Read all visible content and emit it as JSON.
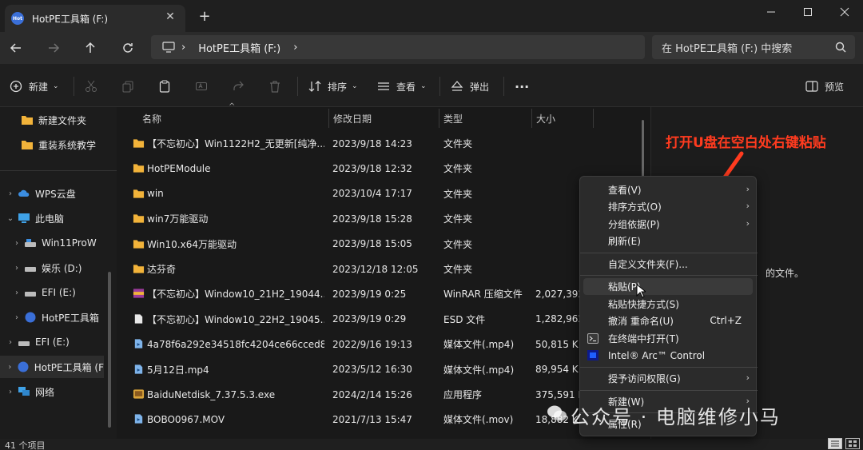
{
  "window": {
    "tab_title": "HotPE工具箱 (F:)",
    "tab_logo_text": "Hot",
    "tab_close": "✕",
    "new_tab": "+"
  },
  "address": {
    "segments": [
      "HotPE工具箱 (F:)"
    ],
    "search_placeholder": "在 HotPE工具箱 (F:) 中搜索"
  },
  "toolbar": {
    "new_label": "新建",
    "sort_label": "排序",
    "view_label": "查看",
    "eject_label": "弹出",
    "more_label": "···",
    "preview_label": "预览"
  },
  "sidebar": {
    "items": [
      {
        "label": "新建文件夹",
        "icon": "folder-icon"
      },
      {
        "label": "重装系统教学",
        "icon": "folder-icon"
      },
      {
        "label": "WPS云盘",
        "icon": "cloud-icon"
      },
      {
        "label": "此电脑",
        "icon": "computer-icon"
      },
      {
        "label": "Win11ProW",
        "icon": "drive-icon"
      },
      {
        "label": "娱乐 (D:)",
        "icon": "drive-icon"
      },
      {
        "label": "EFI (E:)",
        "icon": "drive-icon"
      },
      {
        "label": "HotPE工具箱",
        "icon": "hotpe-icon"
      },
      {
        "label": "EFI (E:)",
        "icon": "drive-icon"
      },
      {
        "label": "HotPE工具箱 (F",
        "icon": "hotpe-icon"
      },
      {
        "label": "网络",
        "icon": "network-icon"
      }
    ]
  },
  "columns": {
    "name": "名称",
    "date": "修改日期",
    "type": "类型",
    "size": "大小"
  },
  "files": [
    {
      "name": "【不忘初心】Win1122H2_无更新[纯净...",
      "date": "2023/9/18 14:23",
      "type": "文件夹",
      "size": "",
      "icon": "folder"
    },
    {
      "name": "HotPEModule",
      "date": "2023/9/18 12:32",
      "type": "文件夹",
      "size": "",
      "icon": "folder"
    },
    {
      "name": "win",
      "date": "2023/10/4 17:17",
      "type": "文件夹",
      "size": "",
      "icon": "folder"
    },
    {
      "name": "win7万能驱动",
      "date": "2023/9/18 15:28",
      "type": "文件夹",
      "size": "",
      "icon": "folder"
    },
    {
      "name": "Win10.x64万能驱动",
      "date": "2023/9/18 15:05",
      "type": "文件夹",
      "size": "",
      "icon": "folder"
    },
    {
      "name": "达芬奇",
      "date": "2023/12/18 12:05",
      "type": "文件夹",
      "size": "",
      "icon": "folder"
    },
    {
      "name": "【不忘初心】Window10_21H2_19044....",
      "date": "2023/9/19 0:25",
      "type": "WinRAR 压缩文件",
      "size": "2,027,392",
      "icon": "rar"
    },
    {
      "name": "【不忘初心】Window10_22H2_19045....",
      "date": "2023/9/19 0:29",
      "type": "ESD 文件",
      "size": "1,282,962",
      "icon": "file"
    },
    {
      "name": "4a78f6a292e34518fc4204ce66cced8...",
      "date": "2022/9/16 19:13",
      "type": "媒体文件(.mp4)",
      "size": "50,815 K",
      "icon": "media"
    },
    {
      "name": "5月12日.mp4",
      "date": "2023/5/12 16:30",
      "type": "媒体文件(.mp4)",
      "size": "89,954 K",
      "icon": "media"
    },
    {
      "name": "BaiduNetdisk_7.37.5.3.exe",
      "date": "2024/2/14 15:26",
      "type": "应用程序",
      "size": "375,591 K",
      "icon": "exe"
    },
    {
      "name": "BOBO0967.MOV",
      "date": "2021/7/13 15:47",
      "type": "媒体文件(.mov)",
      "size": "18,882 K",
      "icon": "media"
    }
  ],
  "preview_pane": {
    "text": "的文件。"
  },
  "status": {
    "count": "41 个项目"
  },
  "annotation": {
    "text": "打开U盘在空白处右键粘贴"
  },
  "context_menu": {
    "items": [
      {
        "label": "查看(V)",
        "arrow": "›"
      },
      {
        "label": "排序方式(O)",
        "arrow": "›"
      },
      {
        "label": "分组依据(P)",
        "arrow": "›"
      },
      {
        "label": "刷新(E)"
      },
      {
        "label": "自定义文件夹(F)..."
      },
      {
        "label": "粘贴(P)"
      },
      {
        "label": "粘贴快捷方式(S)"
      },
      {
        "label": "撤消 重命名(U)",
        "shortcut": "Ctrl+Z"
      },
      {
        "label": "在终端中打开(T)"
      },
      {
        "label": "Intel® Arc™ Control"
      },
      {
        "label": "授予访问权限(G)",
        "arrow": "›"
      },
      {
        "label": "新建(W)",
        "arrow": "›"
      },
      {
        "label": "属性(R)"
      }
    ]
  },
  "watermark": {
    "text": "公众号 · 电脑维修小马"
  },
  "colors": {
    "accent": "#ff3b1f",
    "folder": "#f2b33a",
    "menu_bg": "#2b2b2b"
  }
}
